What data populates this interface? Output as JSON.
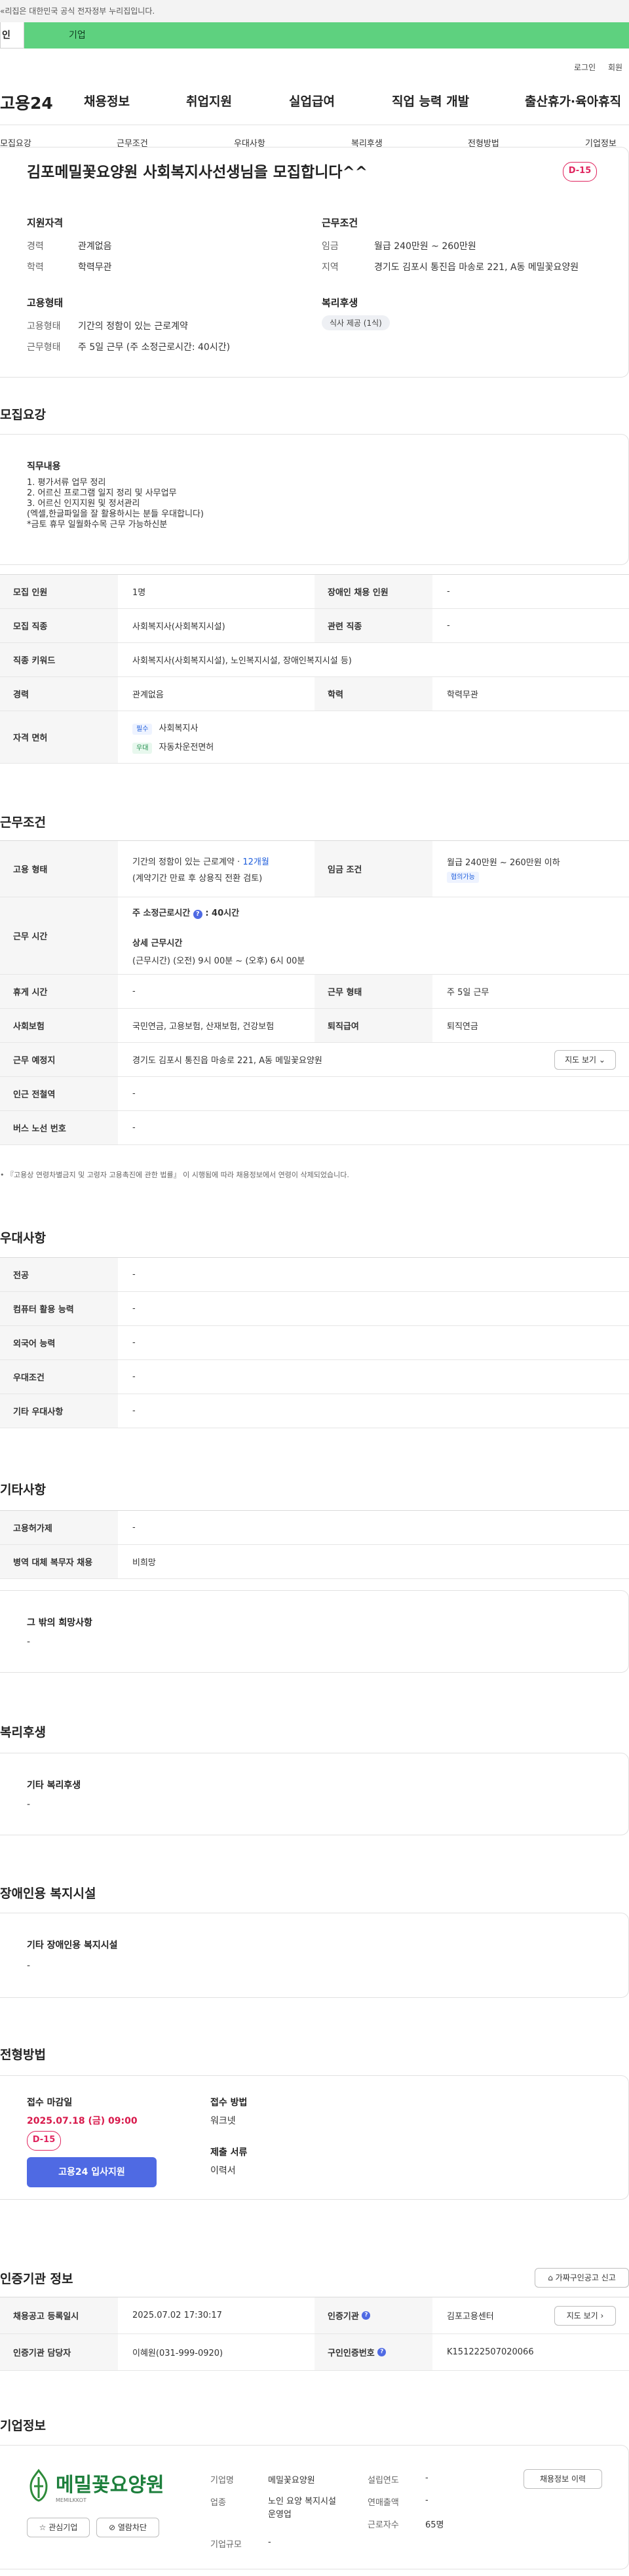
{
  "topbar": {
    "notice": "«리집은 대한민국 공식 전자정부 누리집입니다."
  },
  "tabs": {
    "personal": "인",
    "business": "기업"
  },
  "header": {
    "logo": "고용24",
    "menu": [
      "채용정보",
      "취업지원",
      "실업급여",
      "직업 능력 개발",
      "출산휴가·육아휴직"
    ],
    "util": [
      "로그인",
      "회원"
    ]
  },
  "subnav": [
    "모집요강",
    "근무조건",
    "우대사항",
    "복리후생",
    "전형방법",
    "기업정보"
  ],
  "job": {
    "title": "김포메밀꽃요양원 사회복지사선생님을 모집합니다^^",
    "dday": "D-15",
    "qual": {
      "heading": "지원자격",
      "rows": [
        {
          "label": "경력",
          "value": "관계없음"
        },
        {
          "label": "학력",
          "value": "학력무관"
        }
      ]
    },
    "cond": {
      "heading": "근무조건",
      "rows": [
        {
          "label": "임금",
          "value": "월급 240만원 ~ 260만원"
        },
        {
          "label": "지역",
          "value": "경기도 김포시 통진읍 마송로 221, A동 메밀꽃요양원"
        }
      ]
    },
    "emp": {
      "heading": "고용형태",
      "rows": [
        {
          "label": "고용형태",
          "value": "기간의 정함이 있는 근로계약"
        },
        {
          "label": "근무형태",
          "value": "주 5일 근무 (주 소정근로시간: 40시간)"
        }
      ]
    },
    "welfare": {
      "heading": "복리후생",
      "tag": "식사 제공 (1식)"
    }
  },
  "recruit": {
    "title": "모집요강",
    "duty_heading": "직무내용",
    "duty_lines": [
      "1. 평가서류 업무 정리",
      "2. 어르신 프로그램 일지 정리 및 사무업무",
      "3. 어르신 인지지원 및 정서관리",
      "(엑셀,한글파일을 잘 활용하시는 분들 우대합니다)",
      "*금토 휴무 일월화수목 근무 가능하신분"
    ],
    "table": [
      {
        "k1": "모집 인원",
        "v1": "1명",
        "k2": "장애인 채용 인원",
        "v2": "-"
      },
      {
        "k1": "모집 직종",
        "v1": "사회복지사(사회복지시설)",
        "k2": "관련 직종",
        "v2": "-"
      },
      {
        "k1": "직종 키워드",
        "v1": "사회복지사(사회복지시설), 노인복지시설, 장애인복지시설 등)"
      },
      {
        "k1": "경력",
        "v1": "관계없음",
        "k2": "학력",
        "v2": "학력무관"
      }
    ],
    "license_label": "자격 면허",
    "licenses": [
      {
        "tag": "필수",
        "name": "사회복지사"
      },
      {
        "tag": "우대",
        "name": "자동차운전면허"
      }
    ]
  },
  "work": {
    "title": "근무조건",
    "emp_label": "고용 형태",
    "emp_value": "기간의 정함이 있는 근로계약 · ",
    "emp_months": "12개월",
    "emp_note": "(계약기간 만료 후 상용직 전환 검토)",
    "wage_label": "임금 조건",
    "wage_value": "월급 240만원 ~ 260만원 이하",
    "wage_tag": "협의가능",
    "hours_label": "근무 시간",
    "hours_main": "주 소정근로시간",
    "hours_main_val": ": 40시간",
    "hours_detail_h": "상세 근무시간",
    "hours_detail": "(근무시간) (오전) 9시 00분 ~ (오후) 6시 00분",
    "rows": [
      {
        "k1": "휴게 시간",
        "v1": "-",
        "k2": "근무 형태",
        "v2": "주 5일 근무"
      },
      {
        "k1": "사회보험",
        "v1": "국민연금, 고용보험, 산재보험, 건강보험",
        "k2": "퇴직급여",
        "v2": "퇴직연금"
      }
    ],
    "place_label": "근무 예정지",
    "place_value": "경기도 김포시 통진읍 마송로 221, A동 메밀꽃요양원",
    "map_button": "지도 보기",
    "subway_label": "인근 전철역",
    "subway_value": "-",
    "bus_label": "버스 노선 번호",
    "bus_value": "-",
    "footnote": "『고용상 연령차별금지 및 고령자 고용촉진에 관한 법률』 이 시행됨에 따라 채용정보에서 연령이 삭제되었습니다."
  },
  "pref": {
    "title": "우대사항",
    "rows": [
      {
        "k": "전공",
        "v": "-"
      },
      {
        "k": "컴퓨터 활용 능력",
        "v": "-"
      },
      {
        "k": "외국어 능력",
        "v": "-"
      },
      {
        "k": "우대조건",
        "v": "-"
      },
      {
        "k": "기타 우대사항",
        "v": "-"
      }
    ]
  },
  "etc": {
    "title": "기타사항",
    "rows": [
      {
        "k": "고용허가제",
        "v": "-"
      },
      {
        "k": "병역 대체 복무자 채용",
        "v": "비희망"
      }
    ],
    "other_h": "그 밖의 희망사항",
    "other_v": "-"
  },
  "benefit": {
    "title": "복리후생",
    "h": "기타 복리후생",
    "v": "-"
  },
  "disabled": {
    "title": "장애인용 복지시설",
    "h": "기타 장애인용 복지시설",
    "v": "-"
  },
  "apply": {
    "title": "전형방법",
    "deadline_h": "접수 마감일",
    "deadline": "2025.07.18 (금) 09:00",
    "dday": "D-15",
    "apply_button": "고용24 입사지원",
    "method_h": "접수 방법",
    "method": "워크넷",
    "docs_h": "제출 서류",
    "docs": "이력서"
  },
  "auth": {
    "title": "인증기관 정보",
    "report_button": "가짜구인공고 신고",
    "rows": [
      {
        "k1": "채용공고 등록일시",
        "v1": "2025.07.02 17:30:17",
        "k2": "인증기관",
        "v2": "김포고용센터",
        "btn": "지도 보기"
      },
      {
        "k1": "인증기관 담당자",
        "v1": "이혜원(031-999-0920)",
        "k2": "구인인증번호",
        "v2": "K151222507020066"
      }
    ]
  },
  "company": {
    "title": "기업정보",
    "logo_text": "메밀꽃요양원",
    "logo_sub": "MEMILKKOT",
    "fav_button": "관심기업",
    "block_button": "열람차단",
    "info_button": "채용정보 이력",
    "fields": [
      {
        "k": "기업명",
        "v": "메밀꽃요양원"
      },
      {
        "k": "업종",
        "v": "노인 요양 복지시설 운영업"
      },
      {
        "k": "기업규모",
        "v": "-"
      }
    ],
    "fields2": [
      {
        "k": "설립연도",
        "v": "-"
      },
      {
        "k": "연매출액",
        "v": "-"
      },
      {
        "k": "근로자수",
        "v": "65명"
      }
    ]
  },
  "colors": {
    "accent": "#4f6ae3",
    "green": "#5ed17f",
    "red": "#d81a4c",
    "link": "#1f5edc"
  }
}
